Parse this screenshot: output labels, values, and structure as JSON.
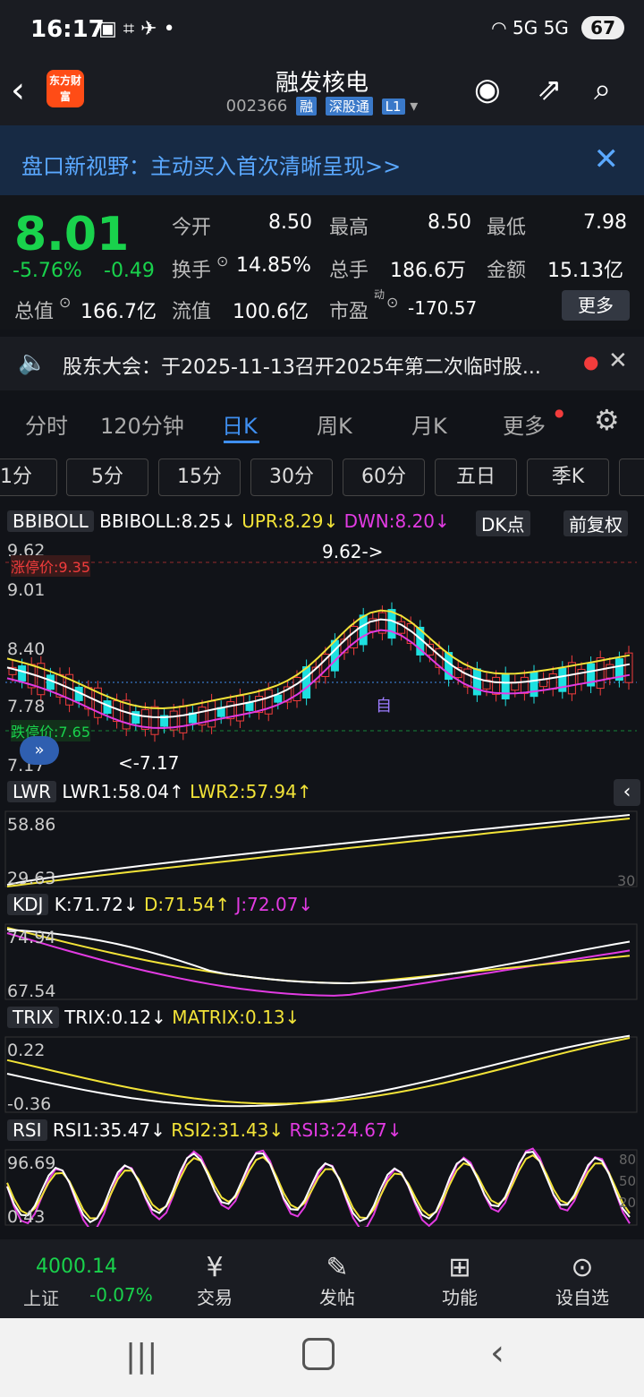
{
  "status": {
    "time": "16:17",
    "signal": "5G 5G",
    "battery": "67"
  },
  "header": {
    "title": "融发核电",
    "code": "002366",
    "tags": [
      "融",
      "深股通",
      "L1"
    ],
    "logo": "东方财富"
  },
  "banner": {
    "text": "盘口新视野：主动买入首次清晰呈现>>"
  },
  "quote": {
    "price": "8.01",
    "pct": "-5.76%",
    "chg": "-0.49",
    "open_lbl": "今开",
    "open": "8.50",
    "high_lbl": "最高",
    "high": "8.50",
    "low_lbl": "最低",
    "low": "7.98",
    "turnover_lbl": "换手",
    "turnover": "14.85%",
    "vol_lbl": "总手",
    "vol": "186.6万",
    "amount_lbl": "金额",
    "amount": "15.13亿",
    "mcap_lbl": "总值",
    "mcap": "166.7亿",
    "float_lbl": "流值",
    "float": "100.6亿",
    "pe_lbl": "市盈",
    "pe_sup": "动",
    "pe": "-170.57",
    "more": "更多"
  },
  "notice": {
    "text": "股东大会：于2025-11-13召开2025年第二次临时股..."
  },
  "tabs": [
    "分时",
    "120分钟",
    "日K",
    "周K",
    "月K",
    "更多"
  ],
  "periods": [
    "1分",
    "5分",
    "15分",
    "30分",
    "60分",
    "五日",
    "季K"
  ],
  "main_ind": {
    "name": "BBIBOLL",
    "v1": "BBIBOLL:8.25↓",
    "v2": "UPR:8.29↓",
    "v3": "DWN:8.20↓",
    "dk": "DK点",
    "fq": "前复权",
    "y1": "9.62",
    "y2": "9.01",
    "y3": "8.40",
    "y4": "7.78",
    "y5": "7.17",
    "limit_up": "涨停价:9.35",
    "limit_down": "跌停价:7.65",
    "hi": "9.62->",
    "lo": "<-7.17",
    "self": "自"
  },
  "lwr": {
    "name": "LWR",
    "v1": "LWR1:58.04↑",
    "v2": "LWR2:57.94↑",
    "y1": "58.86",
    "y2": "29.63",
    "r": "30"
  },
  "kdj": {
    "name": "KDJ",
    "v1": "K:71.72↓",
    "v2": "D:71.54↑",
    "v3": "J:72.07↓",
    "y1": "74.94",
    "y2": "67.54"
  },
  "trix": {
    "name": "TRIX",
    "v1": "TRIX:0.12↓",
    "v2": "MATRIX:0.13↓",
    "y1": "0.22",
    "y2": "-0.36"
  },
  "rsi": {
    "name": "RSI",
    "v1": "RSI1:35.47↓",
    "v2": "RSI2:31.43↓",
    "v3": "RSI3:24.67↓",
    "y1": "96.69",
    "y2": "0.43",
    "r1": "80",
    "r2": "50",
    "r3": "20"
  },
  "bottom": {
    "index_val": "4000.14",
    "index_name": "上证",
    "index_pct": "-0.07%",
    "trade": "交易",
    "post": "发帖",
    "func": "功能",
    "watch": "设自选"
  },
  "colors": {
    "up": "#f23c3c",
    "down": "#1ee0e0",
    "green": "#19d24c",
    "yellow": "#f2e338",
    "magenta": "#e23be2",
    "blue": "#3f8ff0"
  }
}
